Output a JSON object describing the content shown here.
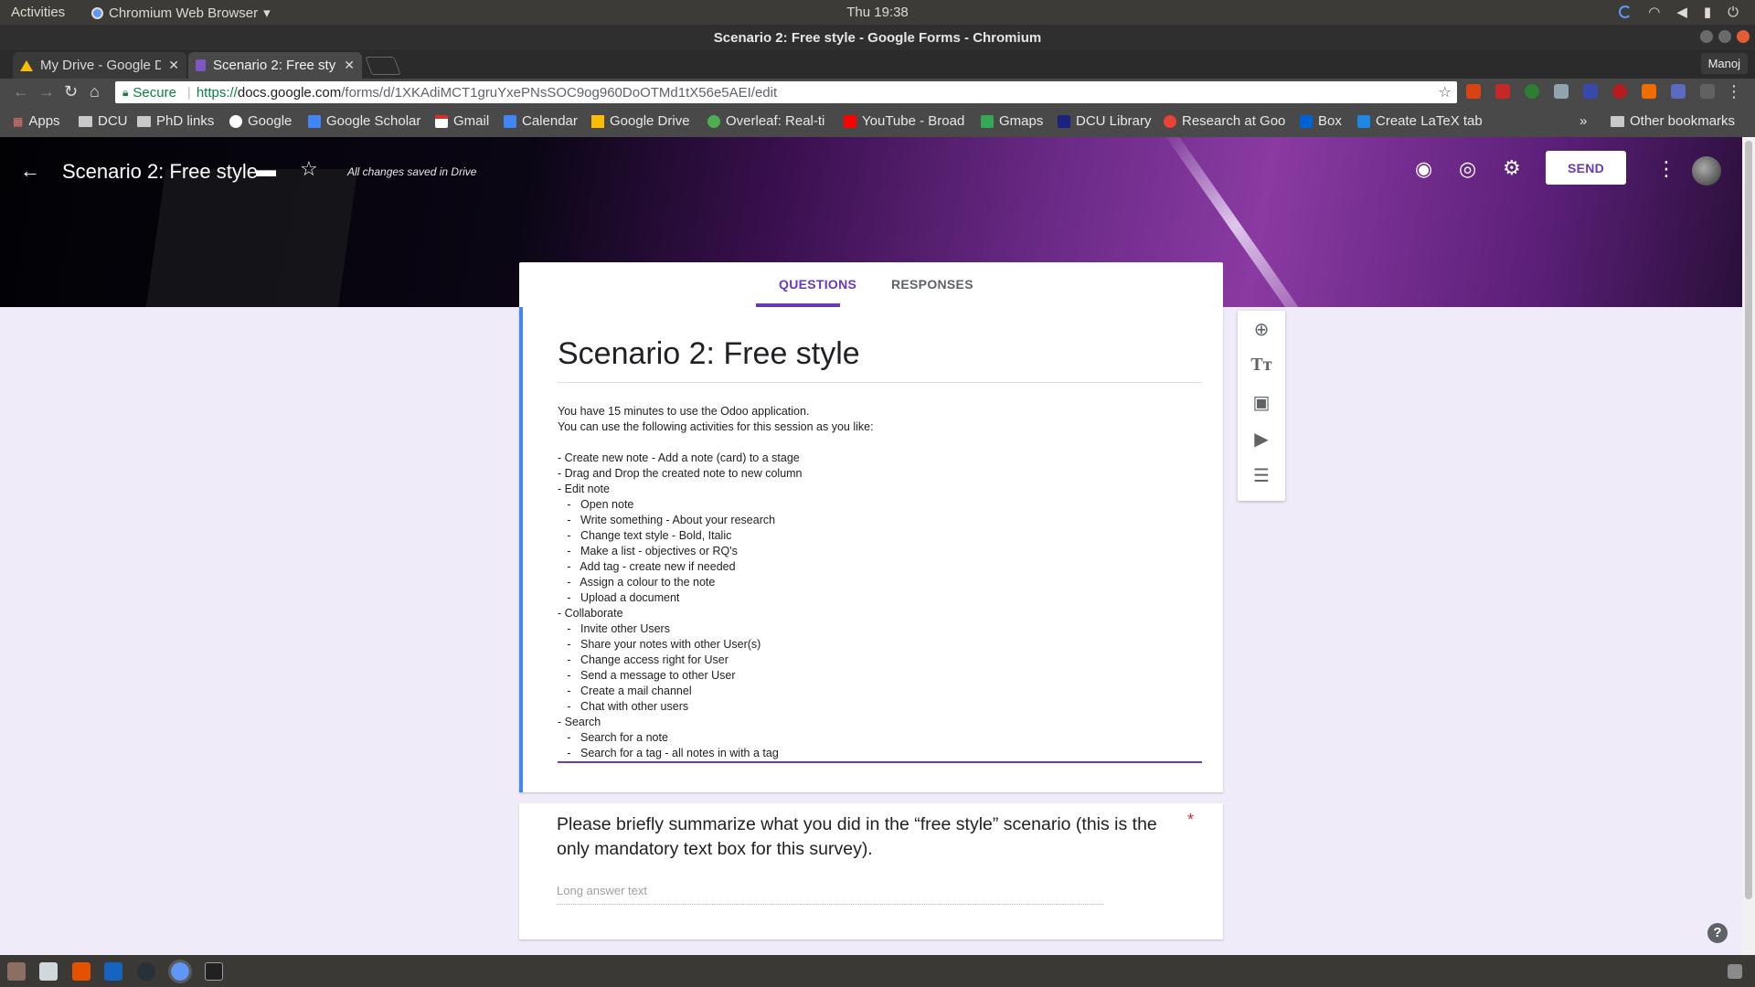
{
  "topbar": {
    "activities": "Activities",
    "app_name": "Chromium Web Browser",
    "clock": "Thu 19:38"
  },
  "window": {
    "title": "Scenario 2: Free style - Google Forms - Chromium",
    "profile": "Manoj"
  },
  "tabs": [
    {
      "label": "My Drive - Google D",
      "icon": "drive-icon",
      "active": false
    },
    {
      "label": "Scenario 2: Free sty",
      "icon": "forms-icon",
      "active": true
    }
  ],
  "address_bar": {
    "secure_label": "Secure",
    "url_prefix": "https://",
    "url_host": "docs.google.com",
    "url_path": "/forms/d/1XKAdiMCT1gruYxePNsSOC9og960DoOTMd1tX56e5AEI/edit"
  },
  "bookmarks": [
    {
      "label": "Apps",
      "icon": "apps-grid-icon"
    },
    {
      "label": "DCU",
      "icon": "folder-icon"
    },
    {
      "label": "PhD links",
      "icon": "folder-icon"
    },
    {
      "label": "Google",
      "icon": "google-icon"
    },
    {
      "label": "Google Scholar",
      "icon": "scholar-icon"
    },
    {
      "label": "Gmail",
      "icon": "gmail-icon"
    },
    {
      "label": "Calendar",
      "icon": "calendar-icon"
    },
    {
      "label": "Google Drive",
      "icon": "drive-icon"
    },
    {
      "label": "Overleaf: Real-ti",
      "icon": "overleaf-icon"
    },
    {
      "label": "YouTube - Broad",
      "icon": "youtube-icon"
    },
    {
      "label": "Gmaps",
      "icon": "maps-icon"
    },
    {
      "label": "DCU Library",
      "icon": "dcu-icon"
    },
    {
      "label": "Research at Goo",
      "icon": "research-icon"
    },
    {
      "label": "Box",
      "icon": "box-icon"
    },
    {
      "label": "Create LaTeX tab",
      "icon": "table-icon"
    }
  ],
  "bookmarks_overflow": "»",
  "other_bookmarks": "Other bookmarks",
  "form_header": {
    "title": "Scenario 2: Free style",
    "saved_status": "All changes saved in Drive",
    "send_label": "SEND"
  },
  "form_tabs": {
    "questions": "QUESTIONS",
    "responses": "RESPONSES"
  },
  "form": {
    "title": "Scenario 2: Free style",
    "description": "You have 15 minutes to use the Odoo application.\nYou can use the following activities for this session as you like:\n\n- Create new note - Add a note (card) to a stage\n- Drag and Drop the created note to new column\n- Edit note\n   -   Open note\n   -   Write something - About your research\n   -   Change text style - Bold, Italic\n   -   Make a list - objectives or RQ's\n   -   Add tag - create new if needed\n   -   Assign a colour to the note\n   -   Upload a document\n- Collaborate\n   -   Invite other Users\n   -   Share your notes with other User(s)\n   -   Change access right for User\n   -   Send a message to other User\n   -   Create a mail channel\n   -   Chat with other users\n- Search\n   -   Search for a note\n   -   Search for a tag - all notes in with a tag"
  },
  "question": {
    "text": "Please briefly summarize what you did in the “free style” scenario (this is the only mandatory text box for this survey).",
    "required_marker": "*",
    "answer_placeholder": "Long answer text"
  },
  "colors": {
    "accent": "#673ab7",
    "form_background": "#f0ebf8",
    "required": "#d93025"
  }
}
